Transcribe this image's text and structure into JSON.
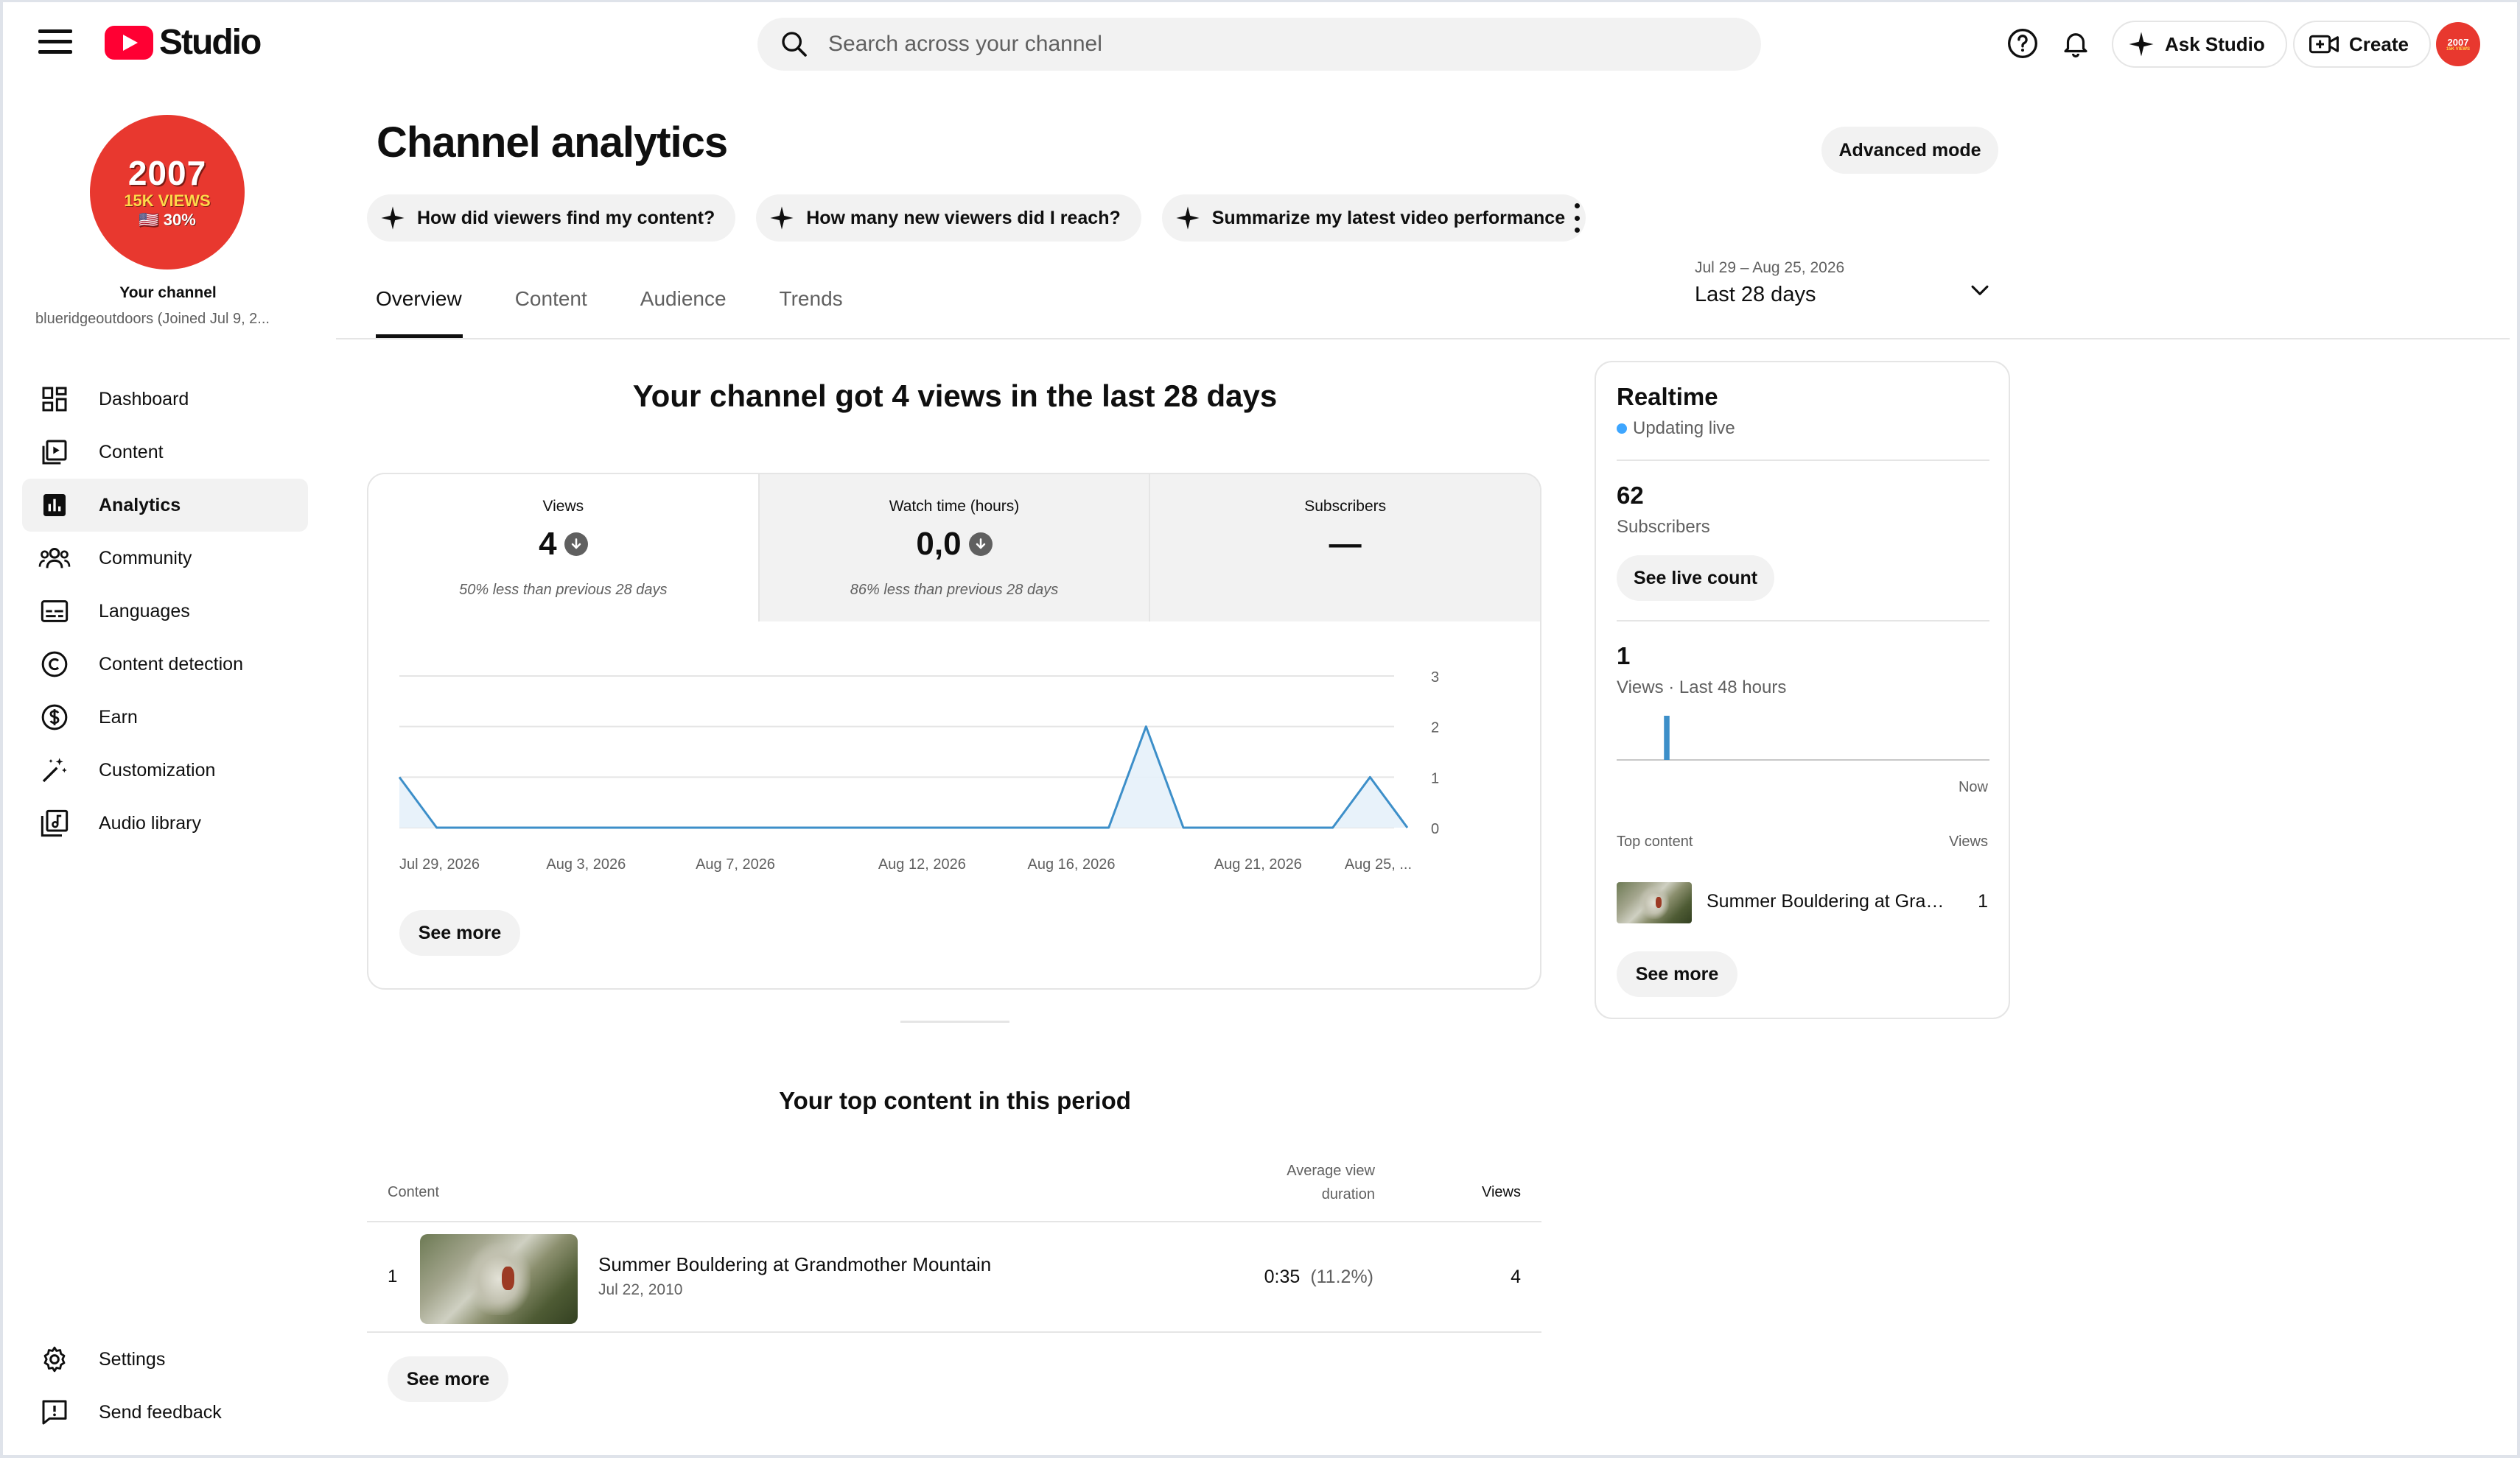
{
  "app": {
    "logo_text": "Studio",
    "brand_color": "#ff0033"
  },
  "search": {
    "placeholder": "Search across your channel"
  },
  "topbar": {
    "ask_studio": "Ask Studio",
    "create": "Create"
  },
  "channel": {
    "avatar_year": "2007",
    "avatar_views": "15K VIEWS",
    "avatar_pct": "🇺🇸 30%",
    "label": "Your channel",
    "handle": "blueridgeoutdoors (Joined Jul 9, 2..."
  },
  "sidebar": {
    "items": [
      {
        "label": "Dashboard",
        "icon": "dashboard-icon"
      },
      {
        "label": "Content",
        "icon": "content-icon"
      },
      {
        "label": "Analytics",
        "icon": "analytics-icon",
        "active": true
      },
      {
        "label": "Community",
        "icon": "community-icon"
      },
      {
        "label": "Languages",
        "icon": "subtitles-icon"
      },
      {
        "label": "Content detection",
        "icon": "copyright-icon"
      },
      {
        "label": "Earn",
        "icon": "dollar-icon"
      },
      {
        "label": "Customization",
        "icon": "magic-wand-icon"
      },
      {
        "label": "Audio library",
        "icon": "audio-library-icon"
      }
    ],
    "bottom": [
      {
        "label": "Settings",
        "icon": "gear-icon"
      },
      {
        "label": "Send feedback",
        "icon": "feedback-icon"
      }
    ]
  },
  "page": {
    "title": "Channel analytics",
    "advanced_mode": "Advanced mode",
    "chips": [
      "How did viewers find my content?",
      "How many new viewers did I reach?",
      "Summarize my latest video performance"
    ],
    "tabs": [
      "Overview",
      "Content",
      "Audience",
      "Trends"
    ],
    "active_tab": "Overview",
    "date_range": {
      "dates": "Jul 29 – Aug 25, 2026",
      "label": "Last 28 days"
    },
    "headline": "Your channel got 4 views in the last 28 days"
  },
  "metrics": [
    {
      "label": "Views",
      "value": "4",
      "trend": "down",
      "note": "50% less than previous 28 days"
    },
    {
      "label": "Watch time (hours)",
      "value": "0,0",
      "trend": "down",
      "note": "86% less than previous 28 days"
    },
    {
      "label": "Subscribers",
      "value": "—",
      "trend": "",
      "note": ""
    }
  ],
  "overview_chart": {
    "see_more": "See more"
  },
  "chart_data": {
    "type": "area",
    "x_tick_labels": [
      "Jul 29, 2026",
      "Aug 3, 2026",
      "Aug 7, 2026",
      "Aug 12, 2026",
      "Aug 16, 2026",
      "Aug 21, 2026",
      "Aug 25, ..."
    ],
    "x": [
      "Jul 29",
      "Jul 30",
      "Jul 31",
      "Aug 1",
      "Aug 2",
      "Aug 3",
      "Aug 4",
      "Aug 5",
      "Aug 6",
      "Aug 7",
      "Aug 8",
      "Aug 9",
      "Aug 10",
      "Aug 11",
      "Aug 12",
      "Aug 13",
      "Aug 14",
      "Aug 15",
      "Aug 16",
      "Aug 17",
      "Aug 18",
      "Aug 19",
      "Aug 20",
      "Aug 21",
      "Aug 22",
      "Aug 23",
      "Aug 24",
      "Aug 25"
    ],
    "series": [
      {
        "values": [
          1,
          0,
          0,
          0,
          0,
          0,
          0,
          0,
          0,
          0,
          0,
          0,
          0,
          0,
          0,
          0,
          0,
          0,
          0,
          0,
          2,
          0,
          0,
          0,
          0,
          0,
          1,
          0
        ]
      }
    ],
    "y_ticks": [
      0,
      1,
      2,
      3
    ],
    "ylim": [
      0,
      3
    ],
    "grid": true,
    "color": "#3d8fc9"
  },
  "top_content": {
    "title": "Your top content in this period",
    "col_content": "Content",
    "col_avd": "Average view duration",
    "col_views": "Views",
    "rows": [
      {
        "rank": "1",
        "title": "Summer Bouldering at Grandmother Mountain",
        "date": "Jul 22, 2010",
        "avd": "0:35",
        "avd_pct": "(11.2%)",
        "views": "4"
      }
    ],
    "see_more": "See more"
  },
  "realtime": {
    "title": "Realtime",
    "status": "Updating live",
    "subscribers_value": "62",
    "subscribers_label": "Subscribers",
    "see_live_count": "See live count",
    "views_value": "1",
    "views_label": "Views · Last 48 hours",
    "now_label": "Now",
    "top_content_label": "Top content",
    "top_views_label": "Views",
    "top_item_title": "Summer Bouldering at Gran...",
    "top_item_views": "1",
    "see_more": "See more",
    "bars": [
      0,
      0,
      0,
      0,
      0,
      0,
      1,
      0,
      0,
      0,
      0,
      0,
      0,
      0,
      0,
      0,
      0,
      0,
      0,
      0,
      0,
      0,
      0,
      0,
      0,
      0,
      0,
      0,
      0,
      0,
      0,
      0,
      0,
      0,
      0,
      0,
      0,
      0,
      0,
      0,
      0,
      0,
      0,
      0,
      0,
      0,
      0,
      0
    ]
  }
}
